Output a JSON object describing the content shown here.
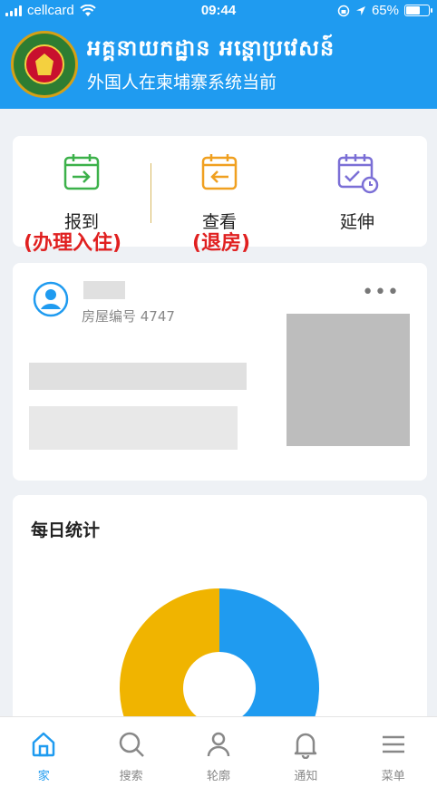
{
  "status_bar": {
    "carrier": "cellcard",
    "time": "09:44",
    "battery": "65%",
    "battery_level": 0.65
  },
  "header": {
    "title_khmer": "អគ្គនាយកដ្ឋាន អន្តោប្រវេសន៍",
    "title_chinese": "外国人在柬埔寨系统当前"
  },
  "actions": [
    {
      "label": "报到",
      "icon": "calendar-checkin-icon",
      "color": "#3cb14a"
    },
    {
      "label": "查看",
      "icon": "calendar-checkout-icon",
      "color": "#f0a020"
    },
    {
      "label": "延伸",
      "icon": "calendar-extend-icon",
      "color": "#7b6fd6"
    }
  ],
  "annotations": {
    "checkin": "(办理入住)",
    "checkout": "(退房)"
  },
  "record": {
    "house_number": "房屋编号 4747",
    "menu_glyph": "•••"
  },
  "stats": {
    "title": "每日统计",
    "colors": [
      "#f0b400",
      "#1f9bf0"
    ]
  },
  "tabbar": [
    {
      "label": "家",
      "icon": "home-icon",
      "active": true
    },
    {
      "label": "搜索",
      "icon": "search-icon",
      "active": false
    },
    {
      "label": "轮廓",
      "icon": "profile-icon",
      "active": false
    },
    {
      "label": "通知",
      "icon": "bell-icon",
      "active": false
    },
    {
      "label": "菜单",
      "icon": "menu-icon",
      "active": false
    }
  ]
}
